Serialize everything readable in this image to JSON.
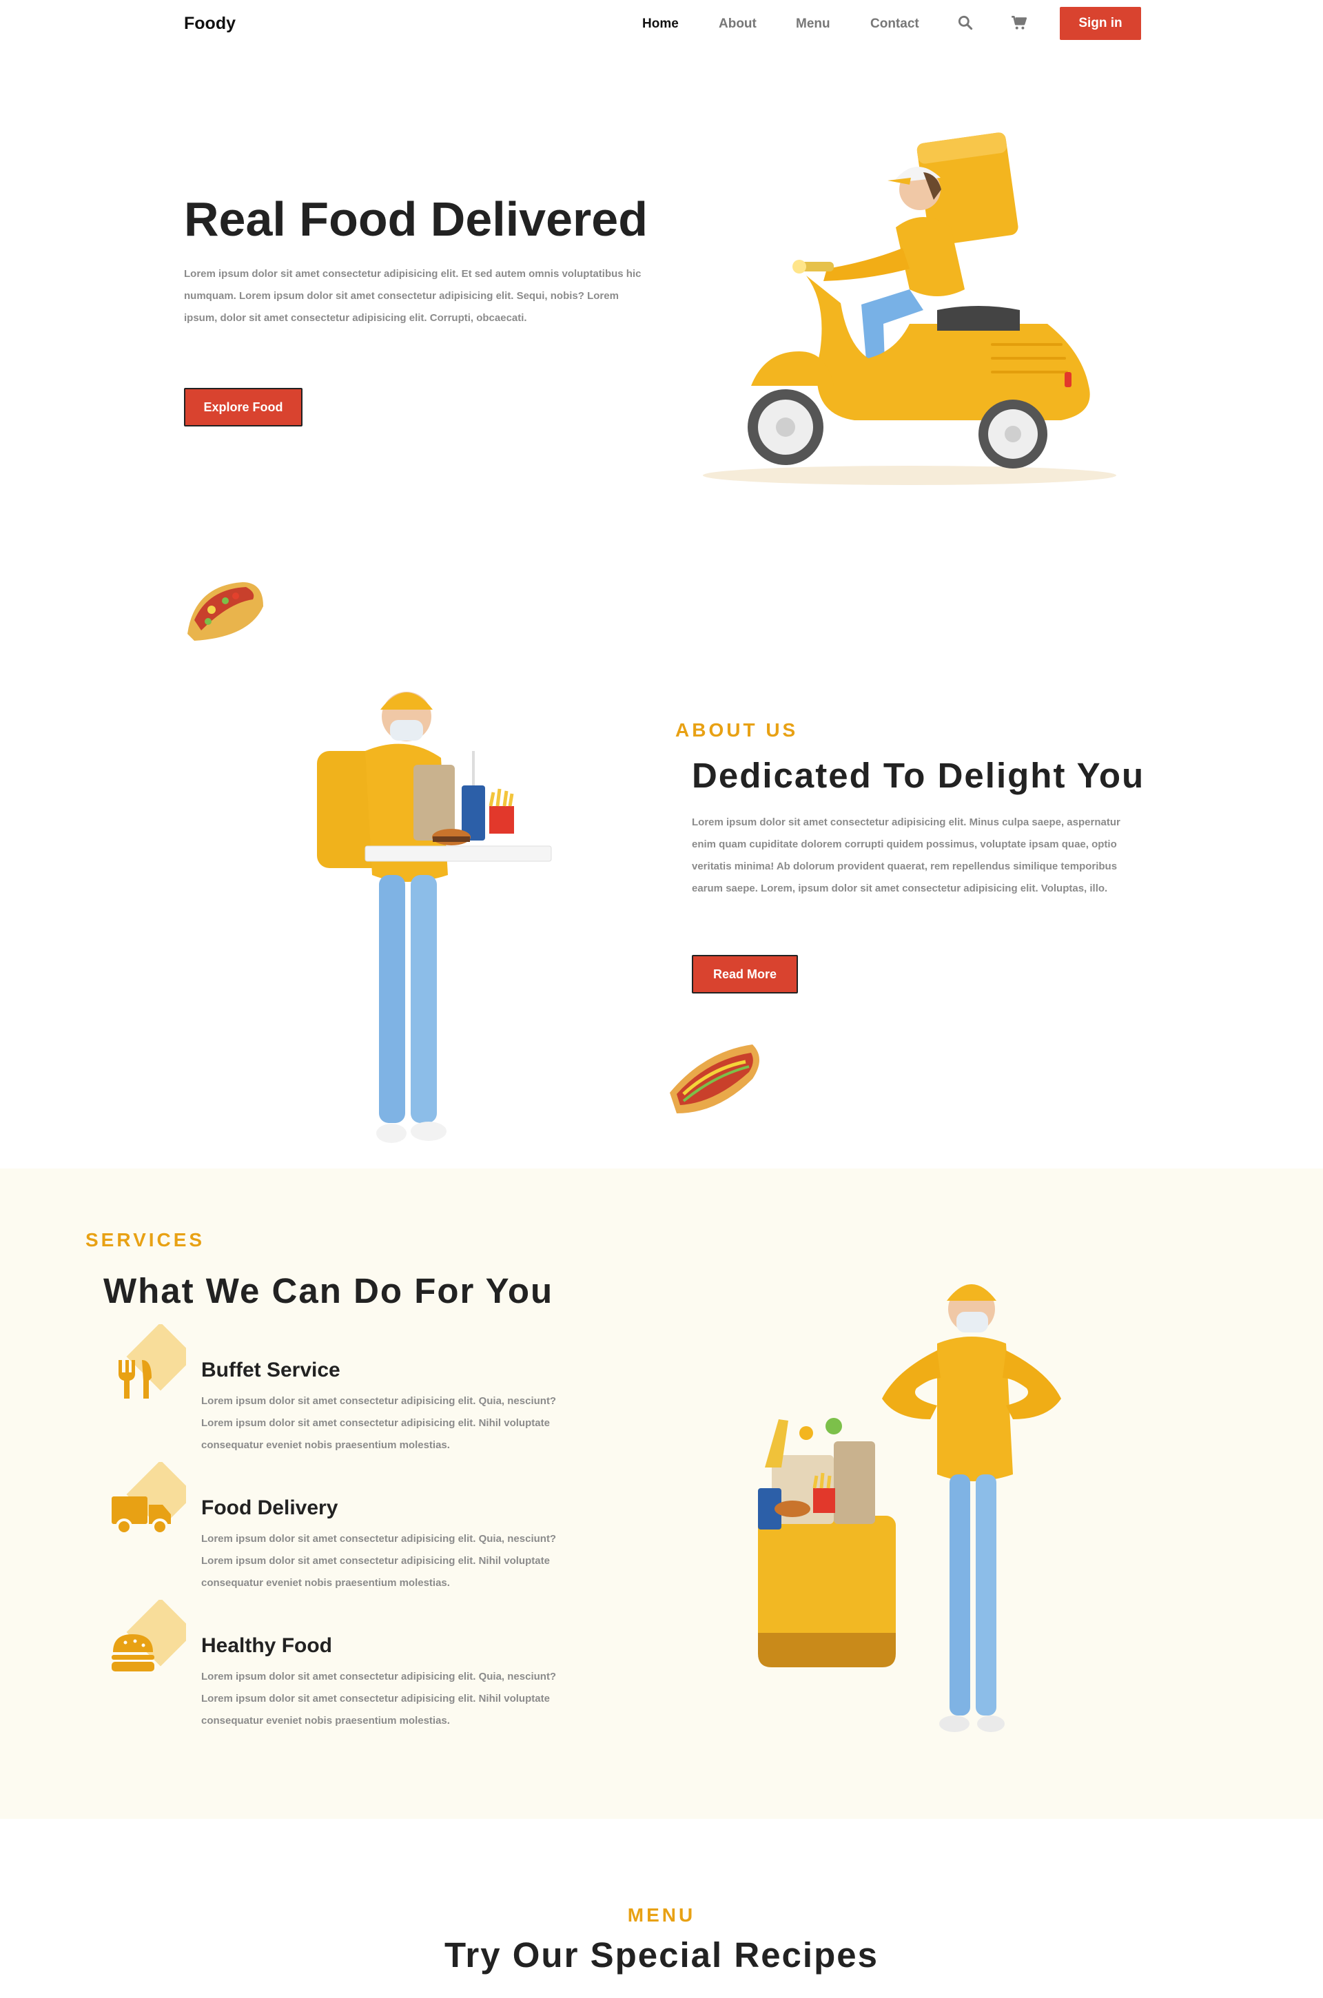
{
  "nav": {
    "logo": "Foody",
    "links": [
      "Home",
      "About",
      "Menu",
      "Contact"
    ],
    "signin": "Sign in",
    "icons": [
      "search-icon",
      "cart-icon"
    ]
  },
  "hero": {
    "title": "Real Food Delivered",
    "text": "Lorem ipsum dolor sit amet consectetur adipisicing elit. Et sed autem omnis voluptatibus hic numquam. Lorem ipsum dolor sit amet consectetur adipisicing elit. Sequi, nobis? Lorem ipsum, dolor sit amet consectetur adipisicing elit. Corrupti, obcaecati.",
    "button": "Explore Food"
  },
  "about": {
    "eyebrow": "ABOUT US",
    "title": "Dedicated To Delight You",
    "text": "Lorem ipsum dolor sit amet consectetur adipisicing elit. Minus culpa saepe, aspernatur enim quam cupiditate dolorem corrupti quidem possimus, voluptate ipsam quae, optio veritatis minima! Ab dolorum provident quaerat, rem repellendus similique temporibus earum saepe. Lorem, ipsum dolor sit amet consectetur adipisicing elit. Voluptas, illo.",
    "button": "Read More"
  },
  "services": {
    "eyebrow": "SERVICES",
    "title": "What We Can Do For You",
    "items": [
      {
        "title": "Buffet Service",
        "icon": "cutlery-icon",
        "text": "Lorem ipsum dolor sit amet consectetur adipisicing elit. Quia, nesciunt? Lorem ipsum dolor sit amet consectetur adipisicing elit. Nihil voluptate consequatur eveniet nobis praesentium molestias."
      },
      {
        "title": "Food Delivery",
        "icon": "truck-icon",
        "text": "Lorem ipsum dolor sit amet consectetur adipisicing elit. Quia, nesciunt? Lorem ipsum dolor sit amet consectetur adipisicing elit. Nihil voluptate consequatur eveniet nobis praesentium molestias."
      },
      {
        "title": "Healthy Food",
        "icon": "burger-icon",
        "text": "Lorem ipsum dolor sit amet consectetur adipisicing elit. Quia, nesciunt? Lorem ipsum dolor sit amet consectetur adipisicing elit. Nihil voluptate consequatur eveniet nobis praesentium molestias."
      }
    ]
  },
  "menu": {
    "eyebrow": "MENU",
    "title": "Try Our Special Recipes"
  },
  "colors": {
    "accent_red": "#d9432f",
    "accent_orange": "#e8a114",
    "services_bg": "#fdfbf1"
  }
}
